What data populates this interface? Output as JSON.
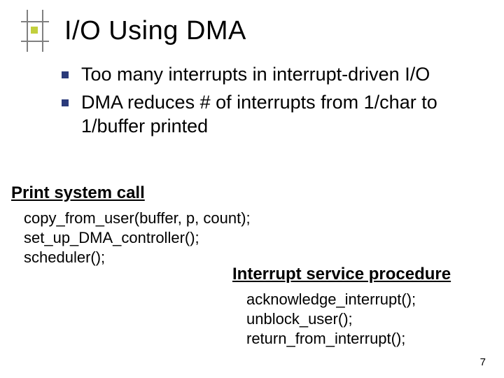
{
  "title": "I/O Using DMA",
  "bullets": [
    "Too many interrupts in interrupt-driven I/O",
    "DMA reduces # of interrupts from 1/char to 1/buffer printed"
  ],
  "sections": {
    "print": {
      "label": "Print system call",
      "code": [
        "copy_from_user(buffer, p, count);",
        "set_up_DMA_controller();",
        "scheduler();"
      ]
    },
    "isr": {
      "label": "Interrupt service procedure",
      "code": [
        "acknowledge_interrupt();",
        "unblock_user();",
        "return_from_interrupt();"
      ]
    }
  },
  "page_number": "7"
}
